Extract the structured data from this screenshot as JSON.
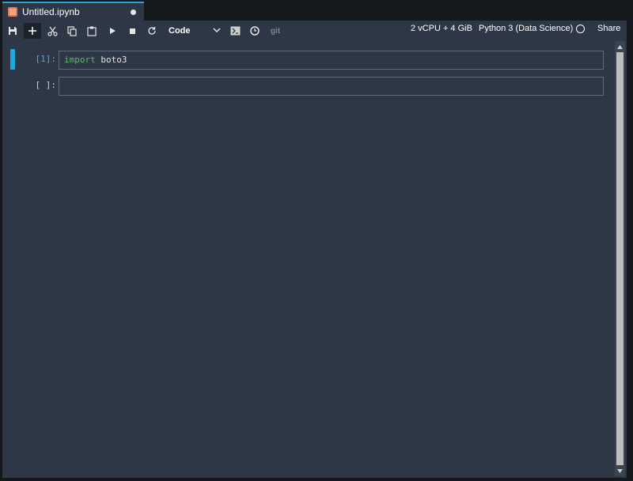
{
  "tab": {
    "title": "Untitled.ipynb",
    "icon": "notebook-icon",
    "unsaved_indicator": "dot"
  },
  "toolbar": {
    "buttons": [
      "save-icon",
      "add-cell-icon",
      "cut-icon",
      "copy-icon",
      "paste-icon",
      "run-icon",
      "stop-icon",
      "restart-icon"
    ],
    "cell_type": "Code",
    "extra_icons": [
      "terminal-icon",
      "clock-icon",
      "git-icon"
    ],
    "git_label": "git",
    "resources": "2 vCPU + 4 GiB",
    "kernel": "Python 3 (Data Science)",
    "share": "Share"
  },
  "cells": [
    {
      "prompt": "[1]:",
      "code_keyword": "import",
      "code_rest": " boto3"
    },
    {
      "prompt": "[ ]:",
      "code_keyword": "",
      "code_rest": ""
    }
  ],
  "colors": {
    "accent": "#1ea7e0",
    "keyword": "#5fb86b",
    "annotation": "#e8101a",
    "panel": "#2d3745"
  }
}
